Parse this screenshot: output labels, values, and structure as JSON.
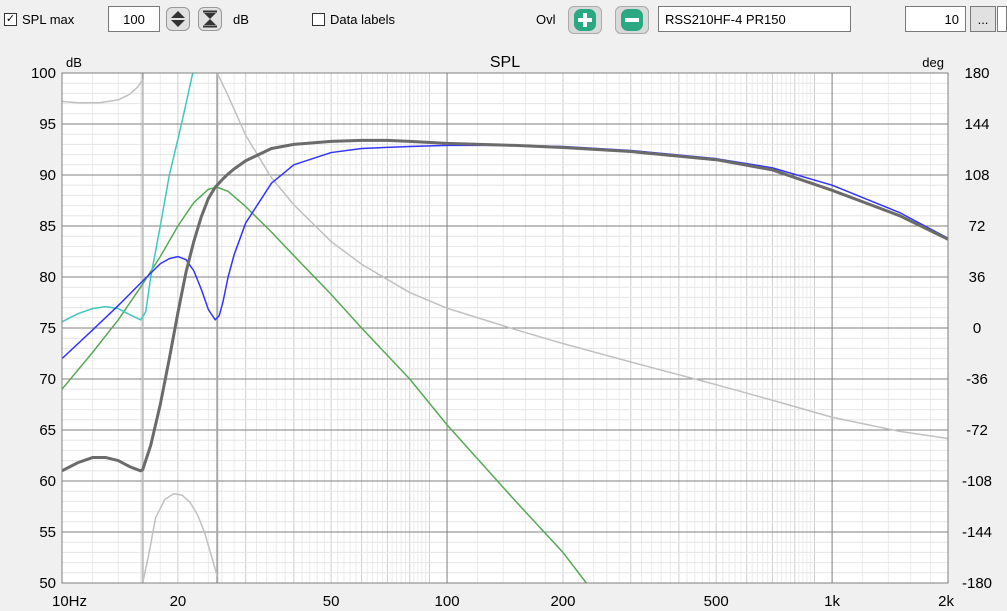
{
  "toolbar": {
    "spl_max_label": "SPL max",
    "spl_max_value": "100",
    "db_unit": "dB",
    "data_labels_label": "Data labels",
    "ovl_label": "Ovl",
    "overlay_name": "RSS210HF-4 PR150",
    "right_value": "10",
    "more_label": "..."
  },
  "colors": {
    "spl_total": "#6b6b6b",
    "port": "#3333ff",
    "cone": "#40c8c0",
    "reference": "#55aa55",
    "phase": "#c0c0c0",
    "grid_major": "#808080",
    "grid_minor": "#cfcfcf",
    "add_button": "#2aa882",
    "remove_button": "#2aa882"
  },
  "icons": [
    "checkbox-checked-icon",
    "up-down-arrows-icon",
    "hourglass-icon",
    "plus-circle-icon",
    "minus-circle-icon"
  ],
  "chart_data": {
    "type": "line",
    "title": "SPL",
    "ylabel": "dB",
    "y2label": "deg",
    "x_scale": "log",
    "xlim": [
      10,
      2000
    ],
    "ylim": [
      50,
      100
    ],
    "y2lim": [
      -180,
      180
    ],
    "grid": true,
    "x_ticks": [
      {
        "value": 10,
        "label": "10Hz"
      },
      {
        "value": 20,
        "label": "20"
      },
      {
        "value": 50,
        "label": "50"
      },
      {
        "value": 100,
        "label": "100"
      },
      {
        "value": 200,
        "label": "200"
      },
      {
        "value": 500,
        "label": "500"
      },
      {
        "value": 1000,
        "label": "1k"
      },
      {
        "value": 2000,
        "label": "2k"
      }
    ],
    "y_ticks": [
      {
        "value": 100,
        "label": "100"
      },
      {
        "value": 95,
        "label": "95"
      },
      {
        "value": 90,
        "label": "90"
      },
      {
        "value": 85,
        "label": "85"
      },
      {
        "value": 80,
        "label": "80"
      },
      {
        "value": 75,
        "label": "75"
      },
      {
        "value": 70,
        "label": "70"
      },
      {
        "value": 65,
        "label": "65"
      },
      {
        "value": 60,
        "label": "60"
      },
      {
        "value": 55,
        "label": "55"
      },
      {
        "value": 50,
        "label": "50"
      }
    ],
    "y2_ticks": [
      {
        "value": 180,
        "label": "180"
      },
      {
        "value": 144,
        "label": "144"
      },
      {
        "value": 108,
        "label": "108"
      },
      {
        "value": 72,
        "label": "72"
      },
      {
        "value": 36,
        "label": "36"
      },
      {
        "value": 0,
        "label": "0"
      },
      {
        "value": -36,
        "label": "-36"
      },
      {
        "value": -72,
        "label": "-72"
      },
      {
        "value": -108,
        "label": "-108"
      },
      {
        "value": -144,
        "label": "-144"
      },
      {
        "value": -180,
        "label": "-180"
      }
    ],
    "markers": [
      16.2,
      25.3
    ],
    "series": [
      {
        "key": "phase_lower",
        "axis": "y2",
        "color": "#c0c0c0",
        "width": 1.5,
        "x": [
          16.2,
          16.8,
          17.5,
          18.5,
          19.5,
          20.5,
          21.5,
          22.5,
          23.5,
          24.5,
          25.3
        ],
        "y": [
          -180,
          -160,
          -134,
          -121,
          -117,
          -118,
          -123,
          -132,
          -145,
          -162,
          -175
        ]
      },
      {
        "key": "phase_upper",
        "axis": "y2",
        "color": "#c0c0c0",
        "width": 1.5,
        "x": [
          10,
          11,
          12.5,
          14,
          15,
          15.7,
          16.2,
          16.2
        ],
        "y": [
          160,
          159,
          159,
          161,
          165,
          170,
          175,
          -180
        ]
      },
      {
        "key": "phase_main",
        "axis": "y2",
        "color": "#c0c0c0",
        "width": 1.5,
        "x": [
          25.3,
          27,
          30,
          35,
          40,
          50,
          60,
          80,
          100,
          150,
          200,
          300,
          500,
          700,
          1000,
          1500,
          2000
        ],
        "y": [
          180,
          164,
          136,
          106,
          87,
          61,
          45,
          25,
          14,
          -1,
          -11,
          -24,
          -40,
          -51,
          -63,
          -73,
          -78
        ]
      },
      {
        "key": "reference",
        "axis": "y",
        "color": "#55aa55",
        "width": 1.5,
        "x": [
          10,
          12,
          14,
          16,
          18,
          20,
          22,
          24,
          25.3,
          27,
          30,
          35,
          40,
          50,
          60,
          80,
          100,
          150,
          200,
          230
        ],
        "y": [
          69,
          72.6,
          75.8,
          79,
          82,
          85,
          87.3,
          88.6,
          88.8,
          88.4,
          86.9,
          84.4,
          82.1,
          78.3,
          75,
          70,
          65.5,
          58.1,
          53,
          50
        ]
      },
      {
        "key": "cone",
        "axis": "y",
        "color": "#40c8c0",
        "width": 1.5,
        "x": [
          10,
          11,
          12,
          13,
          14,
          15,
          16,
          16.5,
          17,
          18,
          19,
          20,
          21,
          22
        ],
        "y": [
          75.6,
          76.4,
          76.9,
          77.1,
          76.9,
          76.3,
          75.8,
          76.6,
          80,
          85,
          90,
          93.5,
          97,
          100.5
        ]
      },
      {
        "key": "port",
        "axis": "y",
        "color": "#3333ff",
        "width": 1.5,
        "x": [
          10,
          12,
          14,
          16,
          18,
          19,
          20,
          21,
          22,
          23,
          24,
          25,
          25.6,
          26.2,
          27,
          28,
          30,
          35,
          40,
          50,
          60,
          80,
          100,
          150,
          200,
          300,
          500,
          700,
          1000,
          1500,
          2000
        ],
        "y": [
          72,
          74.8,
          77.2,
          79.4,
          81.3,
          81.8,
          82,
          81.7,
          80.6,
          78.8,
          76.8,
          75.8,
          76.2,
          77.6,
          80,
          82.2,
          85.3,
          89.2,
          91,
          92.2,
          92.6,
          92.8,
          92.9,
          92.9,
          92.8,
          92.4,
          91.6,
          90.7,
          89,
          86.3,
          83.8
        ]
      },
      {
        "key": "spl_total",
        "axis": "y",
        "color": "#6b6b6b",
        "width": 3,
        "x": [
          10,
          11,
          12,
          13,
          14,
          15,
          16,
          16.2,
          17,
          18,
          19,
          20,
          21,
          22,
          23,
          24,
          25,
          26,
          27,
          28,
          30,
          35,
          40,
          50,
          60,
          70,
          80,
          100,
          150,
          200,
          300,
          500,
          700,
          1000,
          1500,
          2000
        ],
        "y": [
          61,
          61.8,
          62.3,
          62.3,
          62,
          61.4,
          61,
          61.1,
          63.5,
          67.5,
          72,
          76.5,
          80.5,
          83.5,
          85.9,
          87.7,
          88.8,
          89.5,
          90.1,
          90.6,
          91.4,
          92.6,
          93,
          93.3,
          93.4,
          93.4,
          93.3,
          93.1,
          92.9,
          92.7,
          92.3,
          91.5,
          90.5,
          88.5,
          86,
          83.7
        ]
      }
    ]
  }
}
